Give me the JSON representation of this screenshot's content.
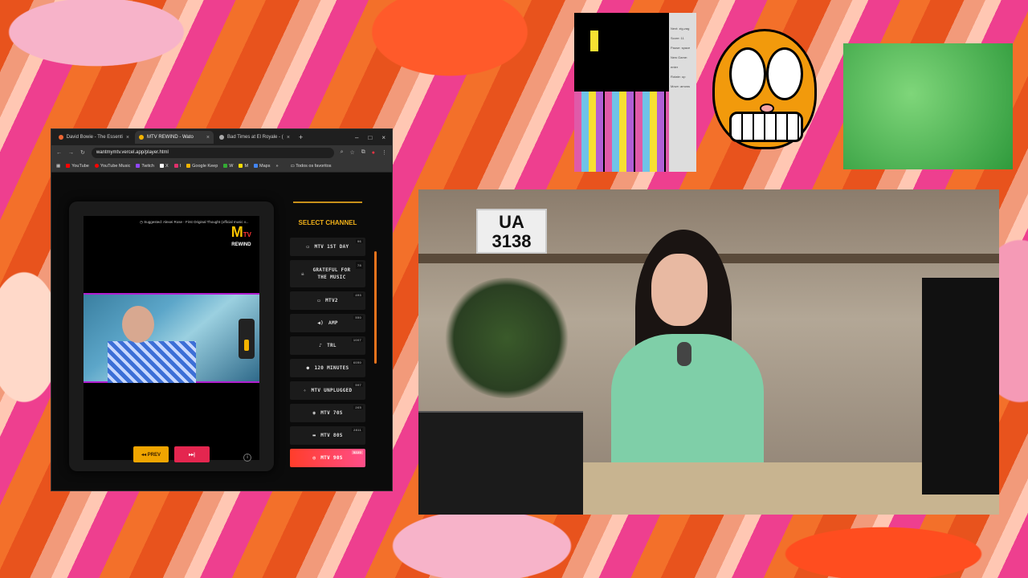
{
  "browser": {
    "tabs": [
      {
        "label": "David Bowie - The Essenti",
        "active": false
      },
      {
        "label": "MTV REWIND - Wato",
        "active": true
      },
      {
        "label": "Bad Times at El Royale - (",
        "active": false
      }
    ],
    "new_tab_symbol": "+",
    "url": "wantmymtv.vercel.app/player.html",
    "bookmarks": [
      "YouTube",
      "YouTube Music",
      "Twitch",
      "X",
      "I",
      "Google Keep",
      "W",
      "M",
      "Maps"
    ],
    "bookmarks_more": "»",
    "all_bookmarks": "Todos os favoritos"
  },
  "player": {
    "suggested_text": "Suggested: Alexei Rose - First Original Thought (official music v...",
    "logo_m": "M",
    "logo_tv": "TV",
    "logo_rewind": "REWIND",
    "prev_label": "◂◂ PREV",
    "next_label": "▸▸|",
    "info_symbol": "i"
  },
  "channels": {
    "heading": "SELECT CHANNEL",
    "items": [
      {
        "label": "MTV 1ST DAY",
        "count": "96",
        "icon": "tv-icon"
      },
      {
        "label": "GRATEFUL FOR THE MUSIC",
        "count": "78",
        "icon": "skull-icon"
      },
      {
        "label": "MTV2",
        "count": "493",
        "icon": "tv-icon"
      },
      {
        "label": "AMP",
        "count": "550",
        "icon": "speaker-icon"
      },
      {
        "label": "TRL",
        "count": "1007",
        "icon": "microphone-icon"
      },
      {
        "label": "120 MINUTES",
        "count": "6050",
        "icon": "record-icon"
      },
      {
        "label": "MTV UNPLUGGED",
        "count": "597",
        "icon": "guitar-icon"
      },
      {
        "label": "MTV 70S",
        "count": "265",
        "icon": "disco-icon"
      },
      {
        "label": "MTV 80S",
        "count": "2811",
        "icon": "cassette-icon"
      },
      {
        "label": "MTV 90S",
        "count": "5220",
        "icon": "cd-icon",
        "active": true
      }
    ]
  },
  "tetris": {
    "sidebar": [
      "Next: zig-zag",
      "Score: 11",
      "Pause: space",
      "New Game: enter",
      "Rotate: up",
      "Move: arrows"
    ]
  },
  "webcam": {
    "plate_line1": "UA",
    "plate_line2": "3138"
  },
  "colors": {
    "accent": "#f0b019",
    "active_channel": "#ff3d2a",
    "next_button": "#e4264f",
    "prev_button": "#f0a500"
  }
}
